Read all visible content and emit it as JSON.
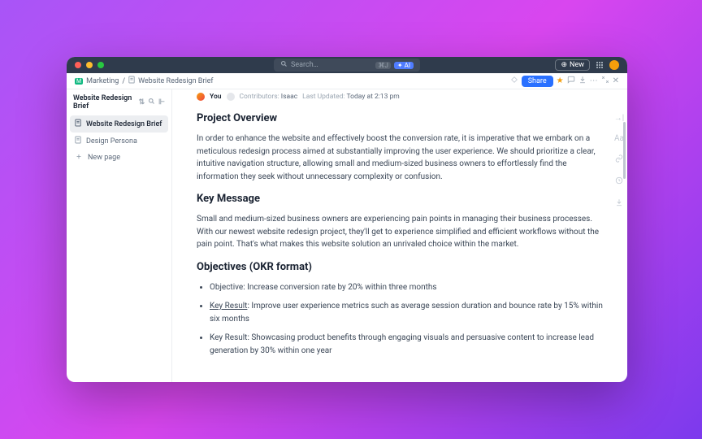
{
  "titlebar": {
    "search_placeholder": "Search…",
    "kbd": "⌘J",
    "ai": "AI",
    "new": "New"
  },
  "crumbs": {
    "workspace": "Marketing",
    "sep": "/",
    "doc": "Website Redesign Brief",
    "share": "Share"
  },
  "sidebar": {
    "title": "Website Redesign Brief",
    "items": [
      {
        "label": "Website Redesign Brief",
        "active": true
      },
      {
        "label": "Design Persona",
        "active": false
      }
    ],
    "new_page": "New page"
  },
  "meta": {
    "you": "You",
    "contributors_label": "Contributors:",
    "contributors": "Isaac",
    "updated_label": "Last Updated:",
    "updated_value": "Today at 2:13 pm"
  },
  "doc": {
    "h1": "Project Overview",
    "p1": "In order to enhance the website and effectively boost the conversion rate, it is imperative that we embark on a meticulous redesign process aimed at substantially improving the user experience. We should prioritize a clear, intuitive navigation structure, allowing small and medium-sized business owners to effortlessly find the information they seek without unnecessary complexity or confusion.",
    "h2": "Key Message",
    "p2": "Small and medium-sized business owners are experiencing pain points in managing their business processes. With our newest website redesign project, they'll get to experience simplified and efficient workflows without the pain point. That's what makes this website solution an unrivaled choice within the market.",
    "h3": "Objectives (OKR format)",
    "obj1": "Objective: Increase conversion rate by 20% within three months",
    "kr_label": "Key Result",
    "kr1_rest": ": Improve user experience metrics such as average session duration and bounce rate by 15% within six months",
    "kr2": "Key Result: Showcasing product benefits through engaging visuals and persuasive content to increase lead generation by 30% within one year"
  }
}
